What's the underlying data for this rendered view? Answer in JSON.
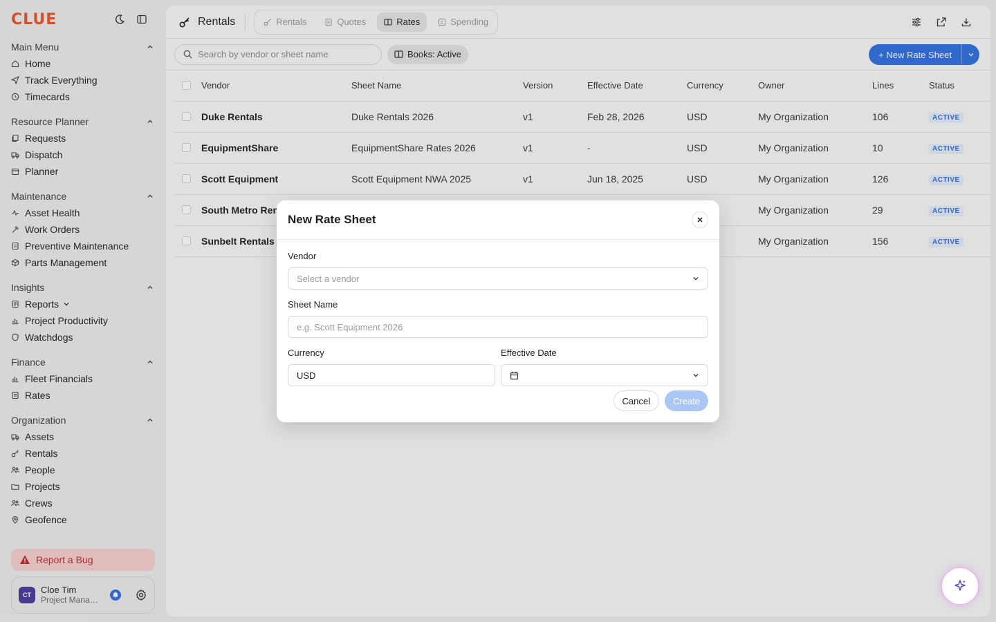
{
  "brand": {
    "logo": "CLUE",
    "accent": "#e8552b"
  },
  "sidebar": {
    "sections": [
      {
        "title": "Main Menu",
        "items": [
          {
            "label": "Home",
            "icon": "home-icon"
          },
          {
            "label": "Track Everything",
            "icon": "send-icon"
          },
          {
            "label": "Timecards",
            "icon": "clock-icon"
          }
        ]
      },
      {
        "title": "Resource Planner",
        "items": [
          {
            "label": "Requests",
            "icon": "copy-icon"
          },
          {
            "label": "Dispatch",
            "icon": "truck-icon"
          },
          {
            "label": "Planner",
            "icon": "calendar-icon"
          }
        ]
      },
      {
        "title": "Maintenance",
        "items": [
          {
            "label": "Asset Health",
            "icon": "pulse-icon"
          },
          {
            "label": "Work Orders",
            "icon": "hammer-icon"
          },
          {
            "label": "Preventive Maintenance",
            "icon": "list-icon"
          },
          {
            "label": "Parts Management",
            "icon": "box-icon"
          }
        ]
      },
      {
        "title": "Insights",
        "items": [
          {
            "label": "Reports",
            "icon": "report-icon"
          },
          {
            "label": "Project Productivity",
            "icon": "chart-icon"
          },
          {
            "label": "Watchdogs",
            "icon": "shield-icon"
          }
        ]
      },
      {
        "title": "Finance",
        "items": [
          {
            "label": "Fleet Financials",
            "icon": "chart-icon"
          },
          {
            "label": "Rates",
            "icon": "list-icon"
          }
        ]
      },
      {
        "title": "Organization",
        "items": [
          {
            "label": "Assets",
            "icon": "truck-icon"
          },
          {
            "label": "Rentals",
            "icon": "key-icon"
          },
          {
            "label": "People",
            "icon": "people-icon"
          },
          {
            "label": "Projects",
            "icon": "folder-icon"
          },
          {
            "label": "Crews",
            "icon": "people-icon"
          },
          {
            "label": "Geofence",
            "icon": "pin-icon"
          }
        ]
      }
    ],
    "bug_label": "Report a Bug",
    "user": {
      "initials": "CT",
      "name": "Cloe Tim",
      "role": "Project Manager"
    }
  },
  "header": {
    "title": "Rentals",
    "tabs": [
      {
        "label": "Rentals",
        "active": false
      },
      {
        "label": "Quotes",
        "active": false
      },
      {
        "label": "Rates",
        "active": true
      },
      {
        "label": "Spending",
        "active": false
      }
    ]
  },
  "toolbar": {
    "search_placeholder": "Search by vendor or sheet name",
    "filter_chip": "Books: Active",
    "new_button": "+ New Rate Sheet"
  },
  "table": {
    "columns": [
      "Vendor",
      "Sheet Name",
      "Version",
      "Effective Date",
      "Currency",
      "Owner",
      "Lines",
      "Status"
    ],
    "rows": [
      [
        "Duke Rentals",
        "Duke Rentals 2026",
        "v1",
        "Feb 28, 2026",
        "USD",
        "My Organization",
        "106",
        "ACTIVE"
      ],
      [
        "EquipmentShare",
        "EquipmentShare Rates 2026",
        "v1",
        "-",
        "USD",
        "My Organization",
        "10",
        "ACTIVE"
      ],
      [
        "Scott Equipment",
        "Scott Equipment NWA 2025",
        "v1",
        "Jun 18, 2025",
        "USD",
        "My Organization",
        "126",
        "ACTIVE"
      ],
      [
        "South Metro Rent",
        "",
        "",
        "",
        "",
        "My Organization",
        "29",
        "ACTIVE"
      ],
      [
        "Sunbelt Rentals",
        "",
        "",
        "",
        "",
        "My Organization",
        "156",
        "ACTIVE"
      ]
    ]
  },
  "modal": {
    "title": "New Rate Sheet",
    "vendor_label": "Vendor",
    "vendor_placeholder": "Select a vendor",
    "sheet_label": "Sheet Name",
    "sheet_placeholder": "e.g. Scott Equipment 2026",
    "currency_label": "Currency",
    "currency_value": "USD",
    "date_label": "Effective Date",
    "cancel": "Cancel",
    "create": "Create"
  }
}
